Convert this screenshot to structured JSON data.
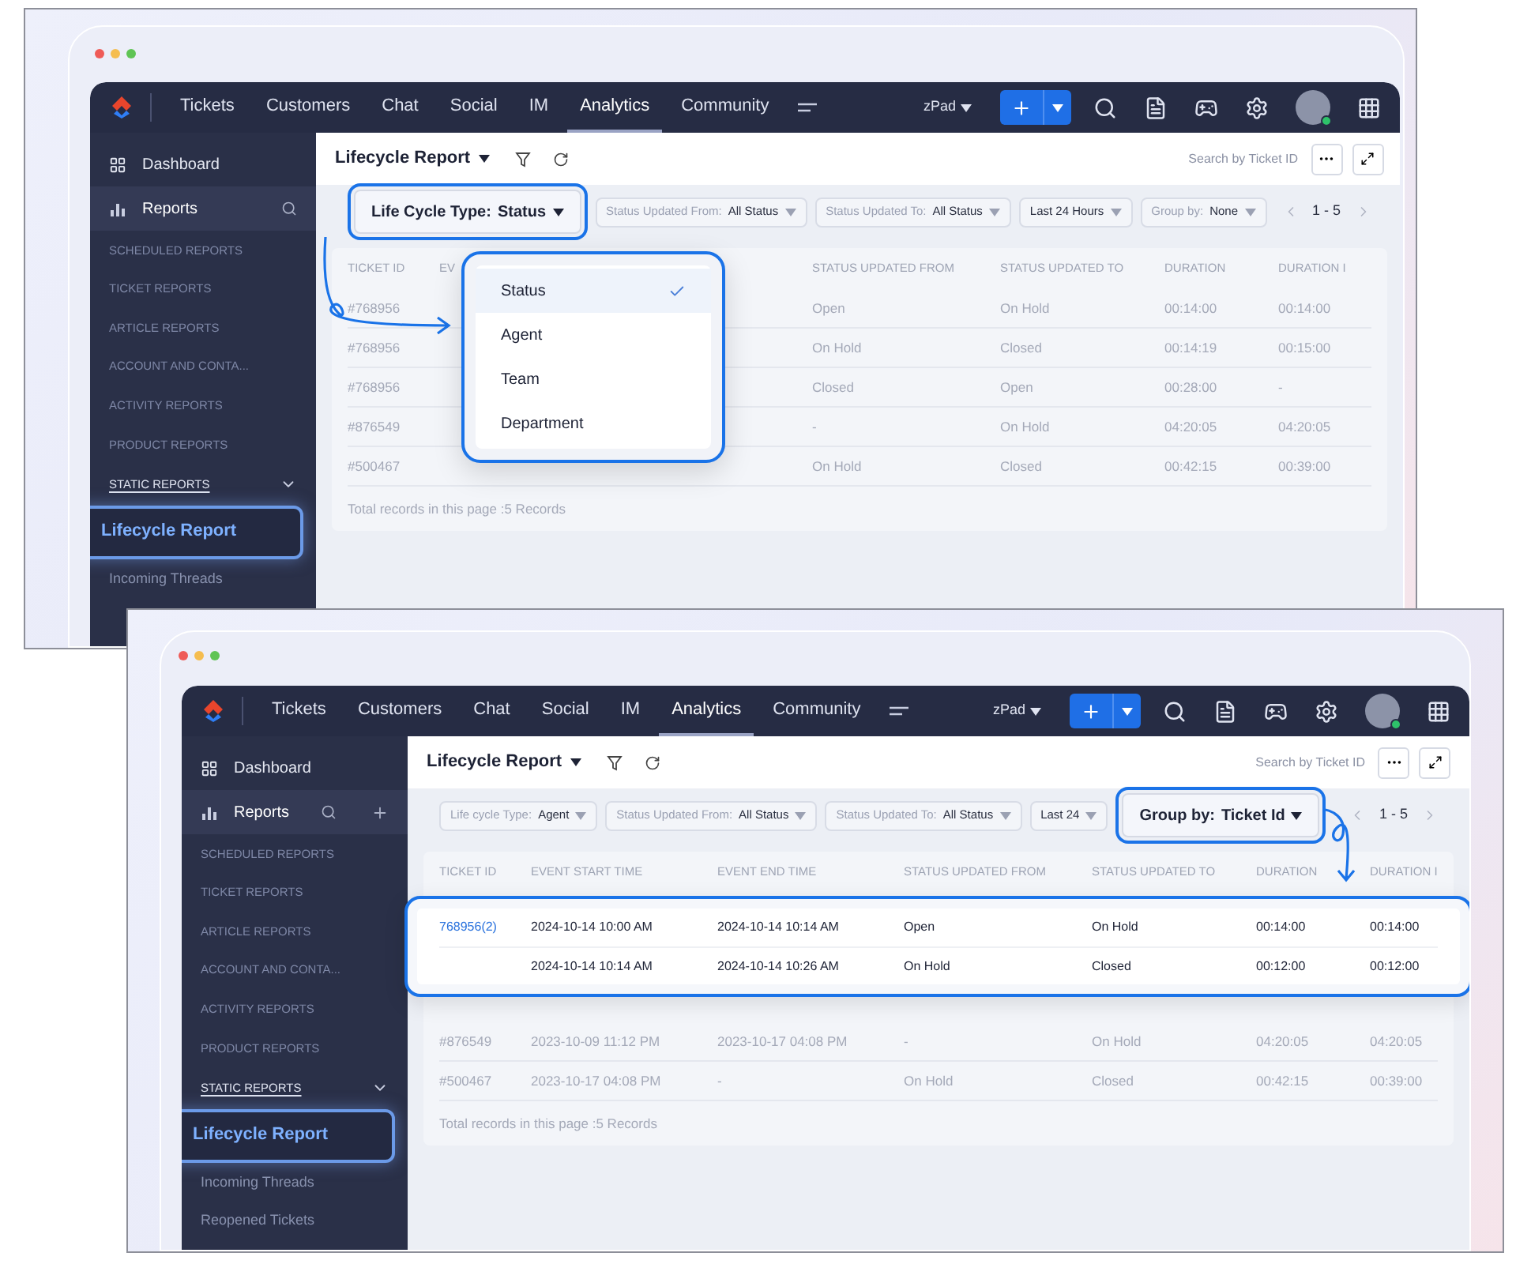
{
  "windows": [
    {
      "nav": {
        "tabs": [
          {
            "label": "Tickets",
            "selected": false
          },
          {
            "label": "Customers",
            "selected": false
          },
          {
            "label": "Chat",
            "selected": false
          },
          {
            "label": "Social",
            "selected": false
          },
          {
            "label": "IM",
            "selected": false
          },
          {
            "label": "Analytics",
            "selected": true
          },
          {
            "label": "Community",
            "selected": false
          }
        ],
        "workspace": "zPad"
      },
      "sidebar": {
        "items": [
          {
            "label": "Dashboard",
            "selected": false,
            "kind": "dashboard"
          },
          {
            "label": "Reports",
            "selected": true,
            "kind": "reports"
          }
        ],
        "show_add": false,
        "sections": [
          "SCHEDULED REPORTS",
          "TICKET REPORTS",
          "ARTICLE REPORTS",
          "ACCOUNT AND CONTA...",
          "ACTIVITY REPORTS",
          "PRODUCT REPORTS"
        ],
        "static_reports": "STATIC REPORTS",
        "highlight": "Lifecycle Report",
        "sub_items": [
          "Incoming Threads"
        ]
      },
      "report": {
        "title": "Lifecycle Report",
        "search_placeholder": "Search by Ticket ID",
        "pagination": "1 - 5",
        "filters": [
          {
            "label": "Life Cycle Type:",
            "value": "Status",
            "highlighted": true
          },
          {
            "label": "Status Updated From:",
            "value": "All Status",
            "highlighted": false
          },
          {
            "label": "Status Updated To:",
            "value": "All Status",
            "highlighted": false
          },
          {
            "value": "Last 24 Hours",
            "highlighted": false
          },
          {
            "label": "Group by:",
            "value": "None",
            "highlighted": false
          }
        ],
        "columns": [
          "TICKET ID",
          "EV",
          "STATUS UPDATED FROM",
          "STATUS UPDATED TO",
          "DURATION",
          "DURATION I"
        ],
        "rows": [
          {
            "ticket_id": "#768956",
            "from": "Open",
            "to": "On Hold",
            "duration": "00:14:00",
            "duration_2": "00:14:00"
          },
          {
            "ticket_id": "#768956",
            "from": "On Hold",
            "to": "Closed",
            "duration": "00:14:19",
            "duration_2": "00:15:00"
          },
          {
            "ticket_id": "#768956",
            "from": "Closed",
            "to": "Open",
            "duration": "00:28:00",
            "duration_2": "-"
          },
          {
            "ticket_id": "#876549",
            "from": "-",
            "to": "On Hold",
            "duration": "04:20:05",
            "duration_2": "04:20:05"
          },
          {
            "ticket_id": "#500467",
            "from": "On Hold",
            "to": "Closed",
            "duration": "00:42:15",
            "duration_2": "00:39:00"
          }
        ],
        "total": "Total records in this page :5 Records"
      },
      "dropdown": {
        "options": [
          {
            "label": "Status",
            "selected": true
          },
          {
            "label": "Agent",
            "selected": false
          },
          {
            "label": "Team",
            "selected": false
          },
          {
            "label": "Department",
            "selected": false
          }
        ]
      }
    },
    {
      "nav": {
        "tabs": [
          {
            "label": "Tickets",
            "selected": false
          },
          {
            "label": "Customers",
            "selected": false
          },
          {
            "label": "Chat",
            "selected": false
          },
          {
            "label": "Social",
            "selected": false
          },
          {
            "label": "IM",
            "selected": false
          },
          {
            "label": "Analytics",
            "selected": true
          },
          {
            "label": "Community",
            "selected": false
          }
        ],
        "workspace": "zPad"
      },
      "sidebar": {
        "items": [
          {
            "label": "Dashboard",
            "selected": false,
            "kind": "dashboard"
          },
          {
            "label": "Reports",
            "selected": true,
            "kind": "reports"
          }
        ],
        "show_add": true,
        "sections": [
          "SCHEDULED REPORTS",
          "TICKET REPORTS",
          "ARTICLE REPORTS",
          "ACCOUNT AND CONTA...",
          "ACTIVITY REPORTS",
          "PRODUCT REPORTS"
        ],
        "static_reports": "STATIC REPORTS",
        "highlight": "Lifecycle Report",
        "sub_items": [
          "Incoming Threads",
          "Reopened Tickets"
        ]
      },
      "report": {
        "title": "Lifecycle Report",
        "search_placeholder": "Search by Ticket ID",
        "pagination": "1 - 5",
        "filters": [
          {
            "label": "Life cycle Type:",
            "value": "Agent",
            "highlighted": false
          },
          {
            "label": "Status Updated From:",
            "value": "All Status",
            "highlighted": false
          },
          {
            "label": "Status Updated To:",
            "value": "All Status",
            "highlighted": false
          },
          {
            "value": "Last 24",
            "highlighted": false
          },
          {
            "label": "Group by:",
            "value": "Ticket Id",
            "highlighted": true
          }
        ],
        "columns": [
          "TICKET ID",
          "EVENT START TIME",
          "EVENT END TIME",
          "STATUS UPDATED FROM",
          "STATUS UPDATED TO",
          "DURATION",
          "DURATION I"
        ],
        "group": {
          "ticket_id": "768956(2)",
          "rows": [
            {
              "event_start": "2024-10-14  10:00 AM",
              "event_end": "2024-10-14  10:14 AM",
              "from": "Open",
              "to": "On Hold",
              "duration": "00:14:00",
              "duration_2": "00:14:00"
            },
            {
              "event_start": "2024-10-14  10:14 AM",
              "event_end": "2024-10-14  10:26 AM",
              "from": "On Hold",
              "to": "Closed",
              "duration": "00:12:00",
              "duration_2": "00:12:00"
            }
          ]
        },
        "rows": [
          {
            "ticket_id": "#876549",
            "event_start": "2023-10-09  11:12 PM",
            "event_end": "2023-10-17  04:08 PM",
            "from": "-",
            "to": "On Hold",
            "duration": "04:20:05",
            "duration_2": "04:20:05"
          },
          {
            "ticket_id": "#500467",
            "event_start": "2023-10-17  04:08 PM",
            "event_end": "-",
            "from": "On Hold",
            "to": "Closed",
            "duration": "00:42:15",
            "duration_2": "00:39:00"
          }
        ],
        "total": "Total records in this page :5 Records"
      }
    }
  ]
}
